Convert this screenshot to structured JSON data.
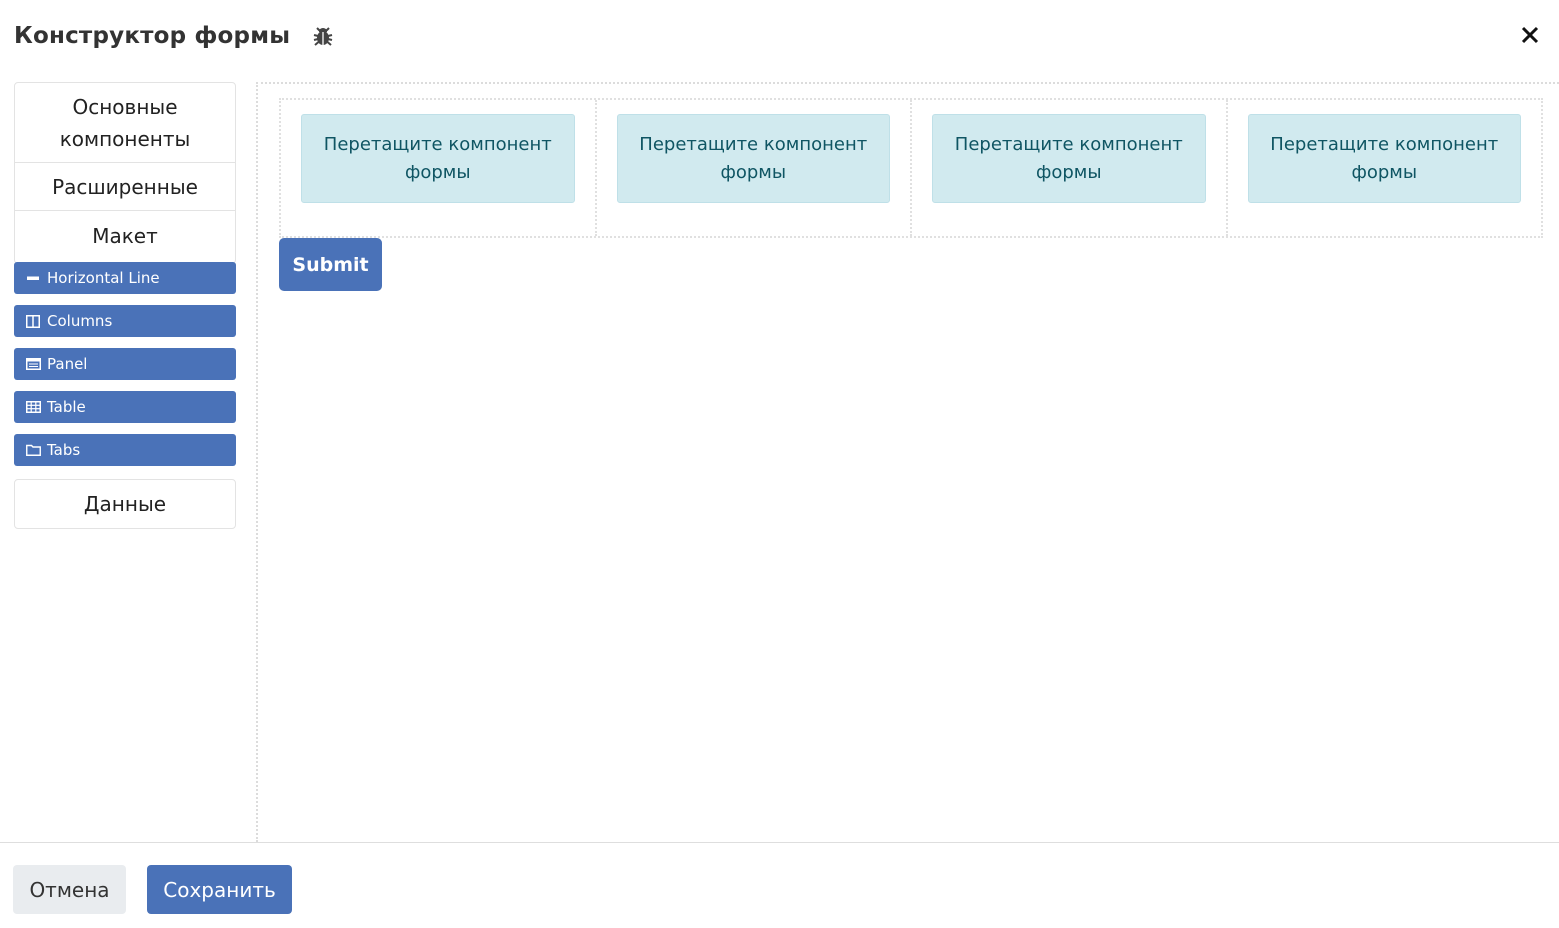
{
  "header": {
    "title": "Конструктор формы",
    "debug_icon": "bug-icon",
    "close_icon": "close-icon"
  },
  "sidebar": {
    "groups": [
      {
        "label": "Основные компоненты"
      },
      {
        "label": "Расширенные"
      },
      {
        "label": "Макет"
      },
      {
        "label": "Данные"
      }
    ],
    "layout_components": [
      {
        "label": "Horizontal Line",
        "icon": "minus-icon"
      },
      {
        "label": "Columns",
        "icon": "columns-icon"
      },
      {
        "label": "Panel",
        "icon": "panel-icon"
      },
      {
        "label": "Table",
        "icon": "table-icon"
      },
      {
        "label": "Tabs",
        "icon": "folder-icon"
      }
    ]
  },
  "canvas": {
    "drop_zones": [
      {
        "text": "Перетащите компонент формы"
      },
      {
        "text": "Перетащите компонент формы"
      },
      {
        "text": "Перетащите компонент формы"
      },
      {
        "text": "Перетащите компонент формы"
      }
    ],
    "submit_label": "Submit"
  },
  "footer": {
    "cancel_label": "Отмена",
    "save_label": "Сохранить"
  },
  "colors": {
    "primary": "#4a72b8",
    "drop_zone_bg": "#d1eaef",
    "drop_zone_text": "#0f5563"
  }
}
